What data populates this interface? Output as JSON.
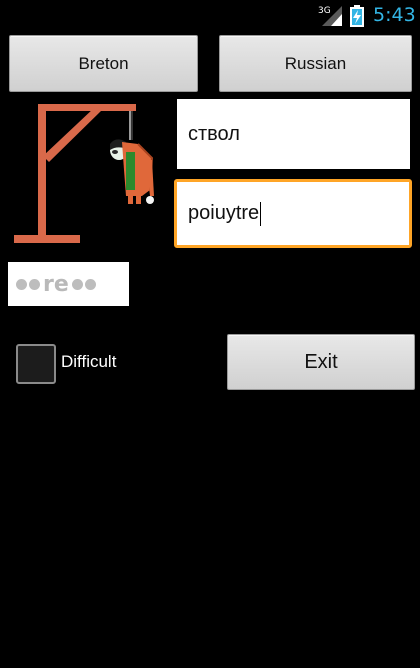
{
  "status_bar": {
    "network_label": "3G",
    "time": "5:43",
    "accent_color": "#33b5e5"
  },
  "buttons": {
    "source_language": "Breton",
    "target_language": "Russian",
    "exit": "Exit"
  },
  "fields": {
    "word_value": "ствол",
    "guess_value": "poiuytre"
  },
  "masked_word": {
    "visible_letters": "re",
    "hidden_count_before": 2,
    "hidden_count_after": 2
  },
  "difficulty": {
    "label": "Difficult",
    "checked": false
  },
  "icons": {
    "signal": "signal-icon",
    "battery": "battery-charging-icon",
    "gallows": "gallows-icon"
  },
  "colors": {
    "focus_border": "#ffa526",
    "gallows": "#d9694a"
  }
}
